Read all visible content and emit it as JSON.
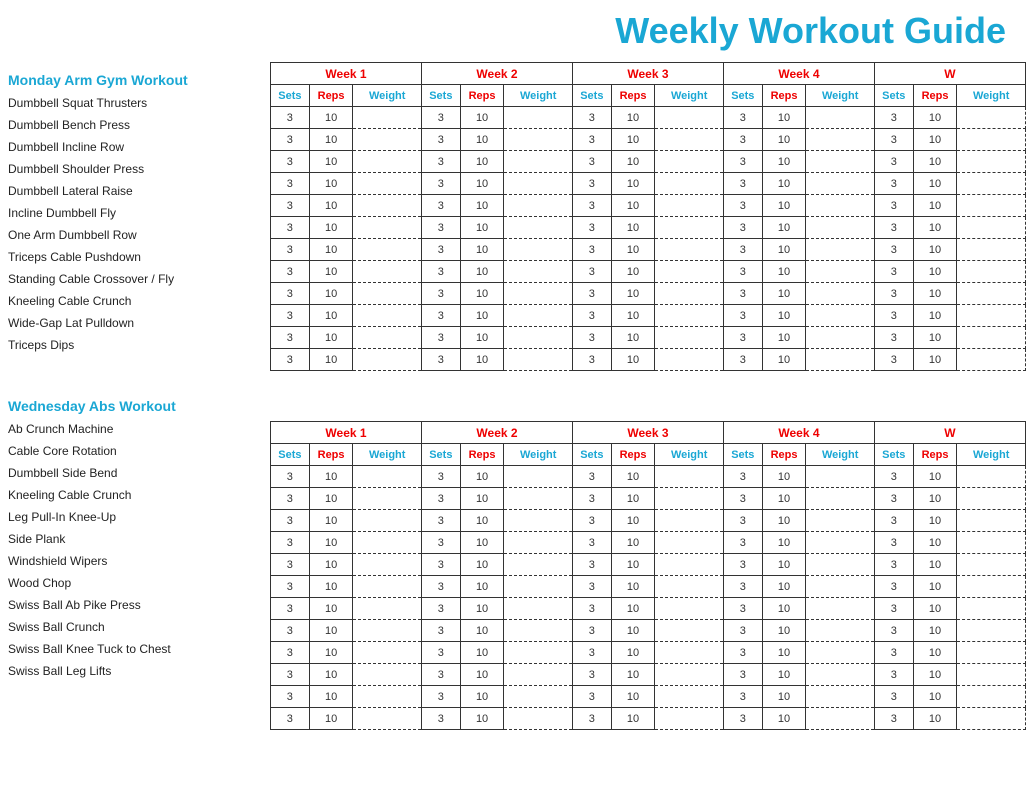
{
  "title": "Weekly Workout Guide",
  "weeks": [
    "Week 1",
    "Week 2",
    "Week 3",
    "Week 4",
    "W"
  ],
  "col_headers": [
    "Sets",
    "Reps",
    "Weight"
  ],
  "sections": [
    {
      "title": "Monday Arm Gym Workout",
      "exercises": [
        "Dumbbell Squat Thrusters",
        "Dumbbell Bench Press",
        "Dumbbell Incline Row",
        "Dumbbell Shoulder Press",
        "Dumbbell Lateral Raise",
        "Incline Dumbbell Fly",
        "One Arm Dumbbell Row",
        "Triceps Cable Pushdown",
        "Standing Cable Crossover / Fly",
        "Kneeling Cable Crunch",
        "Wide-Gap Lat Pulldown",
        "Triceps Dips"
      ],
      "default_sets": "3",
      "default_reps": "10"
    },
    {
      "title": "Wednesday Abs Workout",
      "exercises": [
        "Ab Crunch Machine",
        "Cable Core Rotation",
        "Dumbbell Side Bend",
        "Kneeling Cable Crunch",
        "Leg Pull-In Knee-Up",
        "Side Plank",
        "Windshield Wipers",
        "Wood Chop",
        "Swiss Ball Ab Pike Press",
        "Swiss Ball Crunch",
        "Swiss Ball Knee Tuck to Chest",
        "Swiss Ball Leg Lifts"
      ],
      "default_sets": "3",
      "default_reps": "10"
    }
  ]
}
